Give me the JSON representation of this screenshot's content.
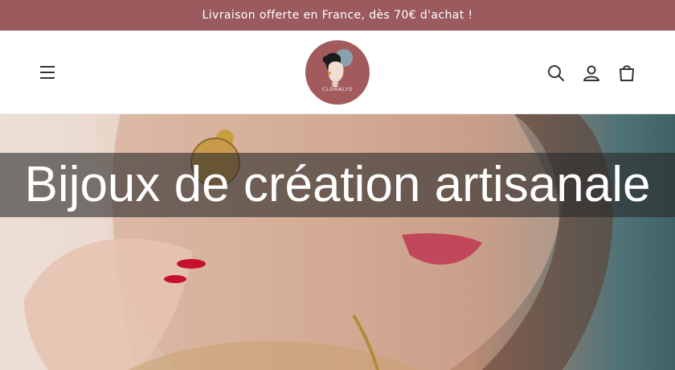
{
  "announcement": {
    "text": "Livraison offerte en France, dès 70€ d'achat !"
  },
  "header": {
    "logo_text": "CLORALYS",
    "icons": [
      "menu-icon",
      "search-icon",
      "account-icon",
      "cart-icon"
    ]
  },
  "hero": {
    "title": "Bijoux de création artisanale"
  },
  "colors": {
    "announcement_bg": "#9a5a5e",
    "logo_bg": "#a35a5d"
  }
}
